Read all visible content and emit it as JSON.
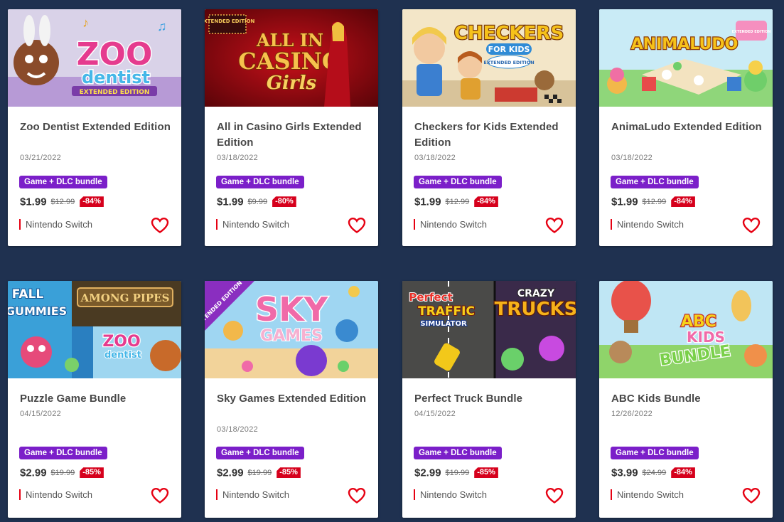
{
  "colors": {
    "page_bg": "#1f3150",
    "badge": "#7b1fc9",
    "discount": "#d6001c",
    "heart": "#e60012"
  },
  "cards": [
    {
      "title": "Zoo Dentist Extended Edition",
      "date": "03/21/2022",
      "badge": "Game + DLC bundle",
      "price": "$1.99",
      "old_price": "$12.99",
      "discount": "-84%",
      "platform": "Nintendo Switch",
      "art_text": [
        "ZOO",
        "dentist",
        "EXTENDED EDITION"
      ]
    },
    {
      "title": "All in Casino Girls Extended Edition",
      "date": "03/18/2022",
      "badge": "Game + DLC bundle",
      "price": "$1.99",
      "old_price": "$9.99",
      "discount": "-80%",
      "platform": "Nintendo Switch",
      "art_text": [
        "ALL IN",
        "CASINO",
        "Girls",
        "EXTENDED EDITION"
      ]
    },
    {
      "title": "Checkers for Kids Extended Edition",
      "date": "03/18/2022",
      "badge": "Game + DLC bundle",
      "price": "$1.99",
      "old_price": "$12.99",
      "discount": "-84%",
      "platform": "Nintendo Switch",
      "art_text": [
        "CHECKERS",
        "FOR KIDS",
        "EXTENDED EDITION"
      ]
    },
    {
      "title": "AnimaLudo Extended Edition",
      "date": "03/18/2022",
      "badge": "Game + DLC bundle",
      "price": "$1.99",
      "old_price": "$12.99",
      "discount": "-84%",
      "platform": "Nintendo Switch",
      "art_text": [
        "ANIMALUDO",
        "EXTENDED EDITION"
      ]
    },
    {
      "title": "Puzzle Game Bundle",
      "date": "04/15/2022",
      "badge": "Game + DLC bundle",
      "price": "$2.99",
      "old_price": "$19.99",
      "discount": "-85%",
      "platform": "Nintendo Switch",
      "art_text": [
        "FALL",
        "GUMMIES",
        "AMONG PIPES",
        "ZOO",
        "dentist"
      ]
    },
    {
      "title": "Sky Games Extended Edition",
      "date": "03/18/2022",
      "badge": "Game + DLC bundle",
      "price": "$2.99",
      "old_price": "$19.99",
      "discount": "-85%",
      "platform": "Nintendo Switch",
      "art_text": [
        "SKY",
        "GAMES",
        "EXTENDED EDITION"
      ]
    },
    {
      "title": "Perfect Truck Bundle",
      "date": "04/15/2022",
      "badge": "Game + DLC bundle",
      "price": "$2.99",
      "old_price": "$19.99",
      "discount": "-85%",
      "platform": "Nintendo Switch",
      "art_text": [
        "Perfect",
        "TRAFFIC",
        "SIMULATOR",
        "CRAZY",
        "TRUCKS"
      ]
    },
    {
      "title": "ABC Kids Bundle",
      "date": "12/26/2022",
      "badge": "Game + DLC bundle",
      "price": "$3.99",
      "old_price": "$24.99",
      "discount": "-84%",
      "platform": "Nintendo Switch",
      "art_text": [
        "ABC",
        "KIDS",
        "BUNDLE"
      ]
    }
  ]
}
